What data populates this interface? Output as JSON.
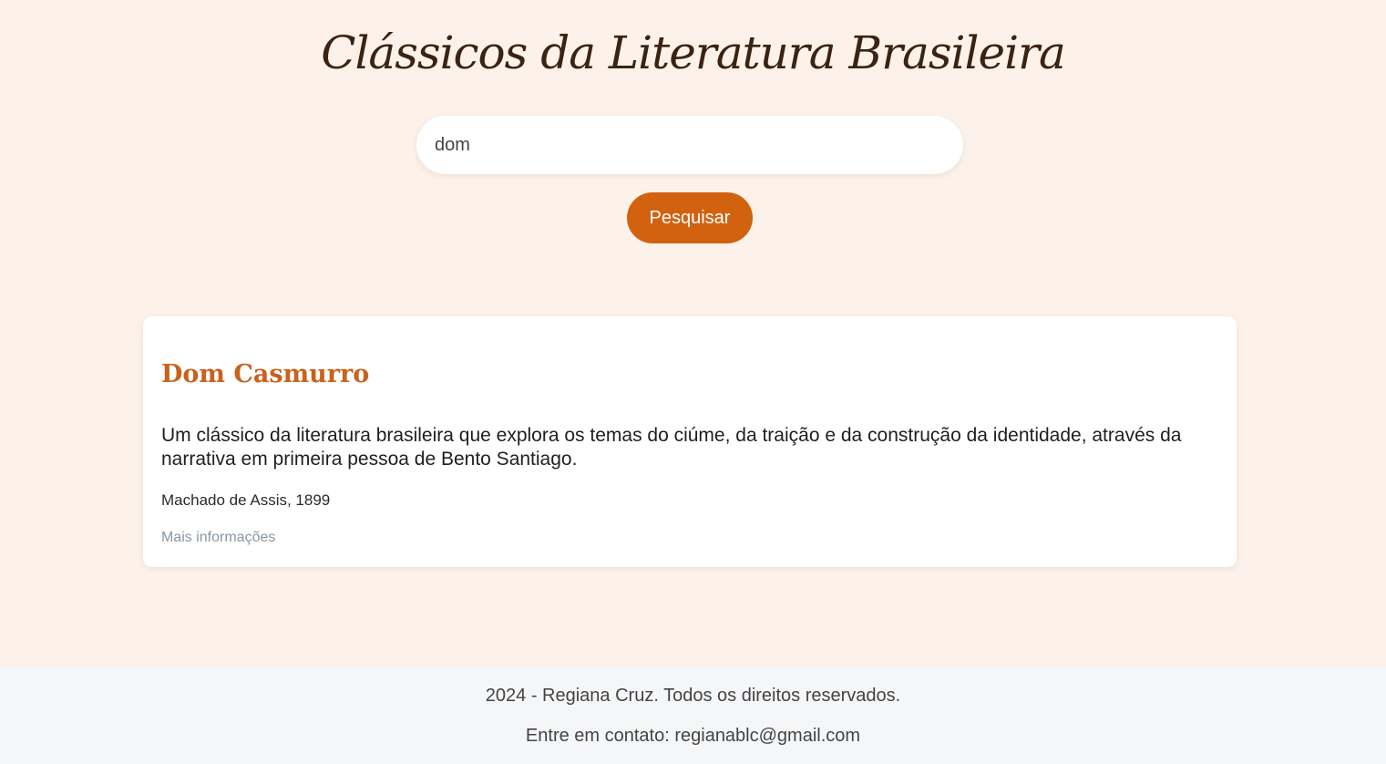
{
  "header": {
    "title": "Clássicos da Literatura Brasileira"
  },
  "search": {
    "value": "dom",
    "button_label": "Pesquisar"
  },
  "results": [
    {
      "title": "Dom Casmurro",
      "description": "Um clássico da literatura brasileira que explora os temas do ciúme, da traição e da construção da identidade, através da narrativa em primeira pessoa de Bento Santiago.",
      "meta": "Machado de Assis, 1899",
      "link_label": "Mais informações"
    }
  ],
  "footer": {
    "copyright": "2024 - Regiana Cruz. Todos os direitos reservados.",
    "contact": "Entre em contato: regianablc@gmail.com"
  },
  "colors": {
    "background": "#fdf2e9",
    "accent": "#d2620f",
    "title": "#3b2314",
    "card_title": "#c8621d"
  }
}
